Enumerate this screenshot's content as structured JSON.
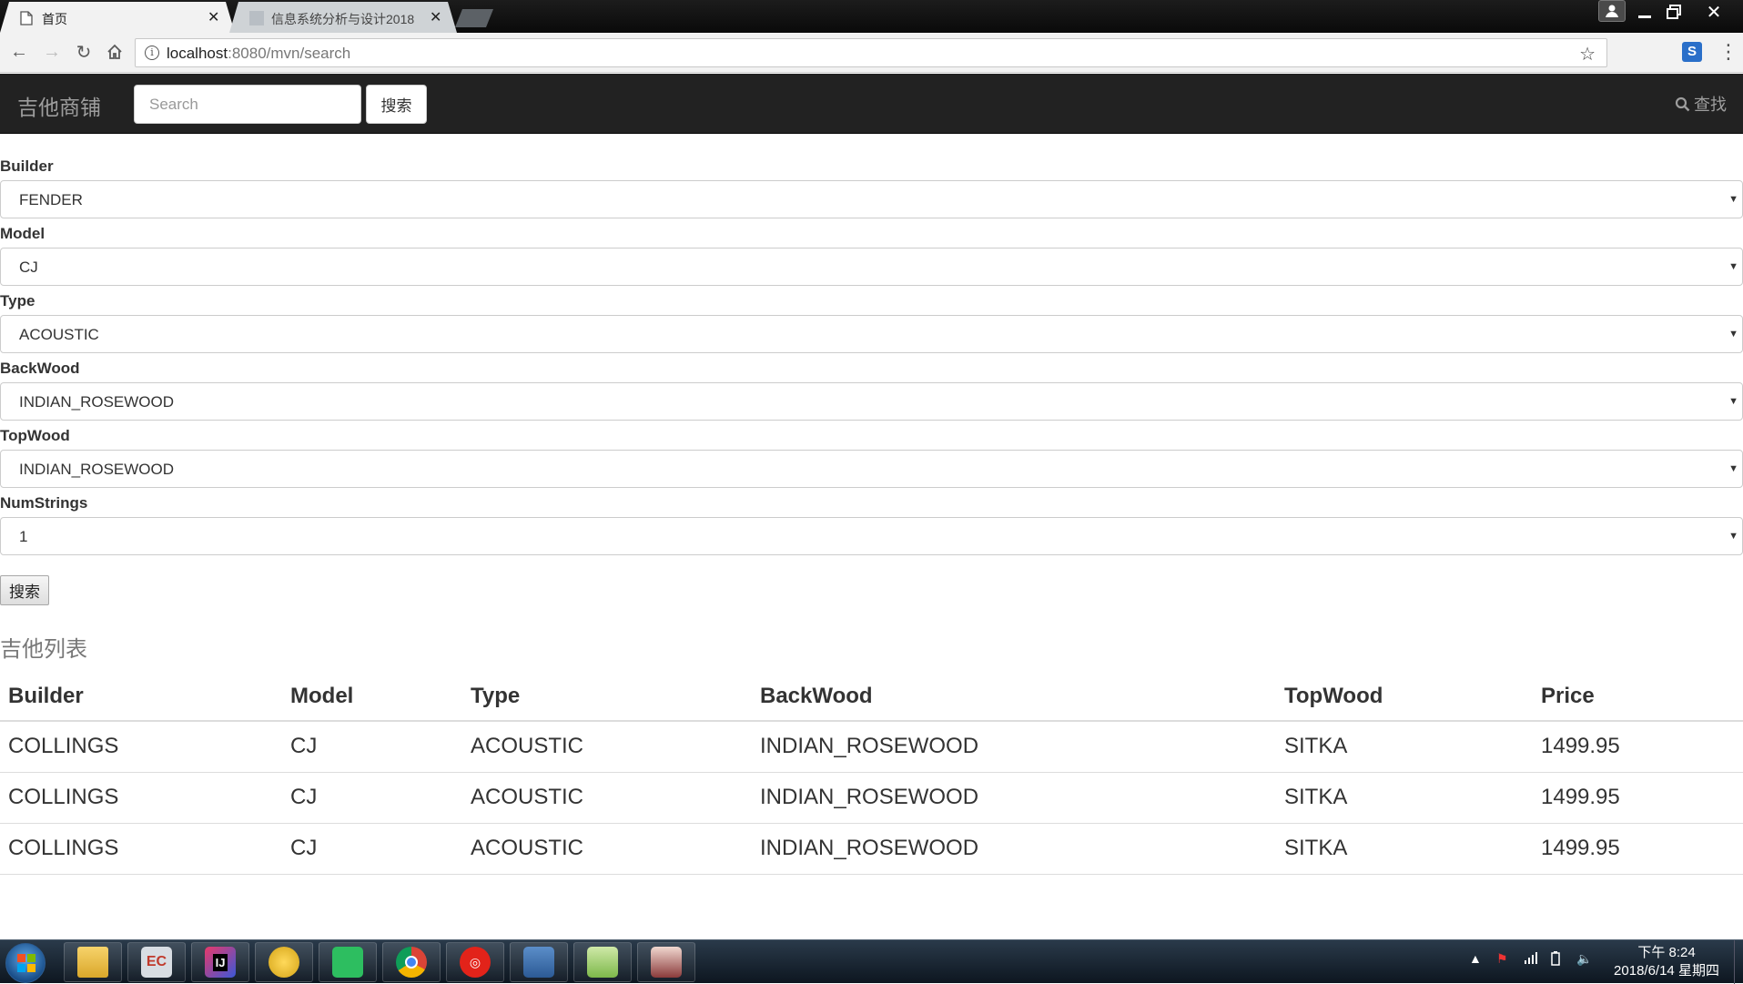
{
  "browser": {
    "tabs": [
      {
        "title": "首页",
        "active": true
      },
      {
        "title": "信息系统分析与设计2018",
        "active": false
      }
    ],
    "url_host": "localhost",
    "url_rest": ":8080/mvn/search"
  },
  "navbar": {
    "brand": "吉他商铺",
    "search_placeholder": "Search",
    "search_button": "搜索",
    "find_label": "查找"
  },
  "form": {
    "fields": [
      {
        "label": "Builder",
        "value": "FENDER"
      },
      {
        "label": "Model",
        "value": "CJ"
      },
      {
        "label": "Type",
        "value": "ACOUSTIC"
      },
      {
        "label": "BackWood",
        "value": "INDIAN_ROSEWOOD"
      },
      {
        "label": "TopWood",
        "value": "INDIAN_ROSEWOOD"
      },
      {
        "label": "NumStrings",
        "value": "1"
      }
    ],
    "submit_label": "搜索"
  },
  "results": {
    "title": "吉他列表",
    "columns": [
      "Builder",
      "Model",
      "Type",
      "BackWood",
      "TopWood",
      "Price"
    ],
    "rows": [
      [
        "COLLINGS",
        "CJ",
        "ACOUSTIC",
        "INDIAN_ROSEWOOD",
        "SITKA",
        "1499.95"
      ],
      [
        "COLLINGS",
        "CJ",
        "ACOUSTIC",
        "INDIAN_ROSEWOOD",
        "SITKA",
        "1499.95"
      ],
      [
        "COLLINGS",
        "CJ",
        "ACOUSTIC",
        "INDIAN_ROSEWOOD",
        "SITKA",
        "1499.95"
      ]
    ]
  },
  "taskbar": {
    "apps": [
      "file-explorer-icon",
      "eclipse-icon",
      "intellij-icon",
      "qq-icon",
      "evernote-icon",
      "chrome-icon",
      "netease-music-icon",
      "remote-desktop-icon",
      "notepad-icon",
      "anime-avatar-icon"
    ],
    "time": "下午 8:24",
    "date": "2018/6/14 星期四"
  }
}
